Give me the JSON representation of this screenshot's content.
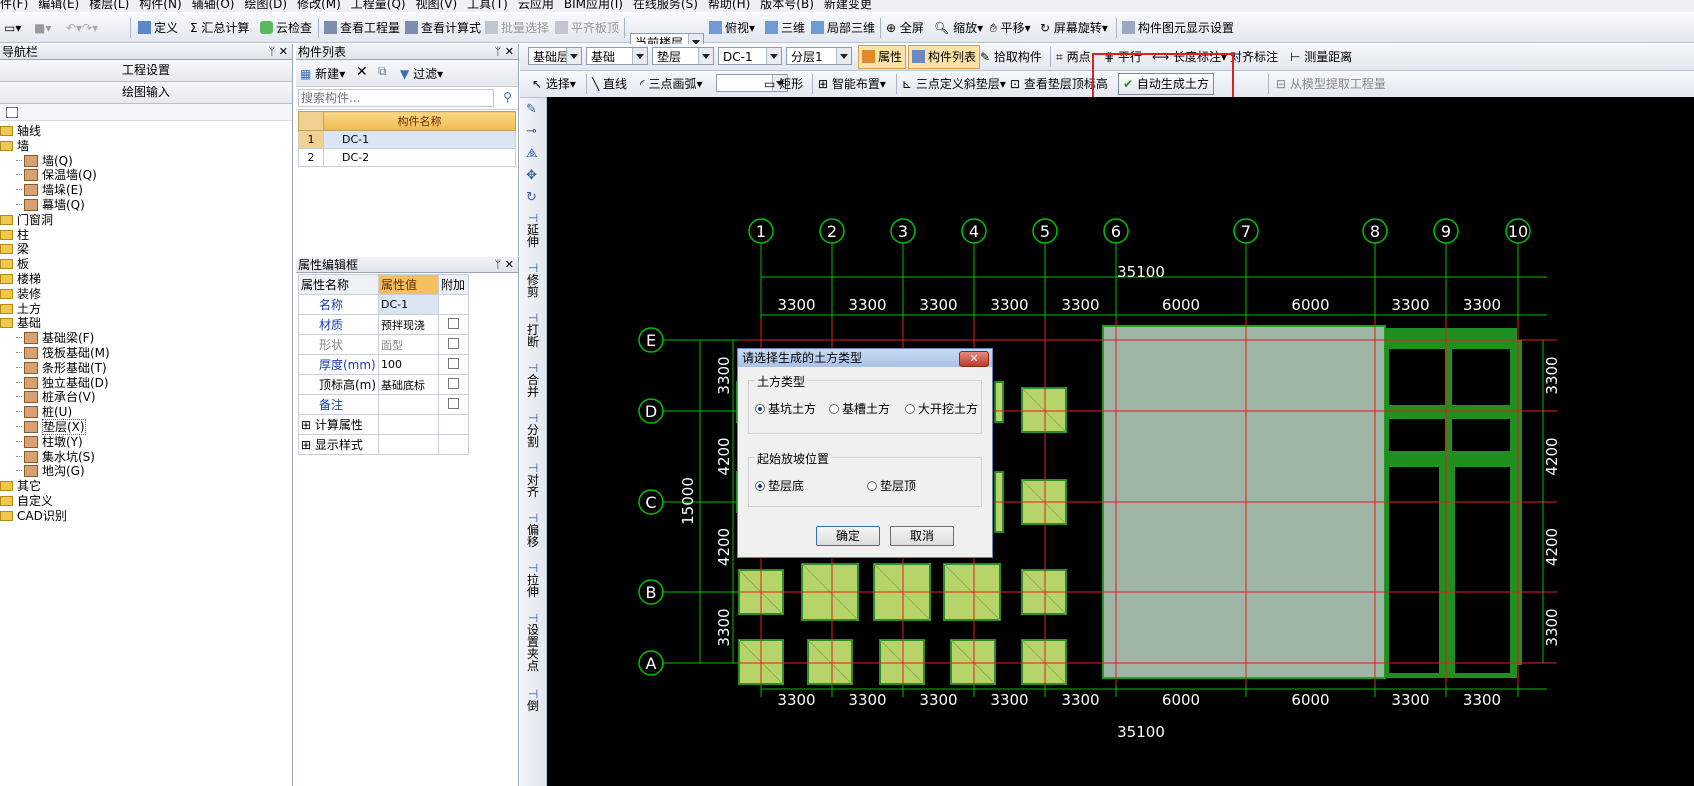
{
  "menu": [
    "件(F)",
    "编辑(E)",
    "楼层(L)",
    "构件(N)",
    "辅轴(O)",
    "绘图(D)",
    "修改(M)",
    "工程量(Q)",
    "视图(V)",
    "工具(T)",
    "云应用",
    "BIM应用(I)",
    "在线服务(S)",
    "帮助(H)",
    "版本号(B)",
    "新建变更"
  ],
  "toolbar1": {
    "define": "定义",
    "summary": "汇总计算",
    "cloud_check": "云检查",
    "view_qty": "查看工程量",
    "view_formula": "查看计算式",
    "batch_select": "批量选择",
    "flat_slab": "平齐板顶",
    "floor": "当前楼层",
    "top_view": "俯视",
    "three_d": "三维",
    "local_3d": "局部三维",
    "fullscreen": "全屏",
    "zoom": "缩放",
    "pan": "平移",
    "rotate": "屏幕旋转",
    "display_settings": "构件图元显示设置"
  },
  "toolbar2": {
    "layer": "基础层",
    "category": "基础",
    "type": "垫层",
    "component": "DC-1",
    "sublayer": "分层1",
    "props": "属性",
    "comp_list": "构件列表",
    "pick": "拾取构件",
    "two_point": "两点",
    "parallel": "平行",
    "length_dim": "长度标注",
    "align_dim": "对齐标注",
    "measure": "测量距离"
  },
  "toolbar3": {
    "select": "选择",
    "line": "直线",
    "arc": "三点画弧",
    "rect": "矩形",
    "smart": "智能布置",
    "slope": "三点定义斜垫层",
    "view_top": "查看垫层顶标高",
    "auto_earth": "自动生成土方",
    "extract": "从模型提取工程量"
  },
  "nav": {
    "title": "导航栏",
    "project_settings": "工程设置",
    "draw_input": "绘图输入",
    "tree": [
      {
        "label": "轴线",
        "level": 0,
        "kind": "folder"
      },
      {
        "label": "墙",
        "level": 0,
        "kind": "folder"
      },
      {
        "label": "墙(Q)",
        "level": 1,
        "kind": "item"
      },
      {
        "label": "保温墙(Q)",
        "level": 1,
        "kind": "item"
      },
      {
        "label": "墙垛(E)",
        "level": 1,
        "kind": "item"
      },
      {
        "label": "幕墙(Q)",
        "level": 1,
        "kind": "item"
      },
      {
        "label": "门窗洞",
        "level": 0,
        "kind": "folder"
      },
      {
        "label": "柱",
        "level": 0,
        "kind": "folder"
      },
      {
        "label": "梁",
        "level": 0,
        "kind": "folder"
      },
      {
        "label": "板",
        "level": 0,
        "kind": "folder"
      },
      {
        "label": "楼梯",
        "level": 0,
        "kind": "folder"
      },
      {
        "label": "装修",
        "level": 0,
        "kind": "folder"
      },
      {
        "label": "土方",
        "level": 0,
        "kind": "folder"
      },
      {
        "label": "基础",
        "level": 0,
        "kind": "folder"
      },
      {
        "label": "基础梁(F)",
        "level": 1,
        "kind": "item"
      },
      {
        "label": "筏板基础(M)",
        "level": 1,
        "kind": "item"
      },
      {
        "label": "条形基础(T)",
        "level": 1,
        "kind": "item"
      },
      {
        "label": "独立基础(D)",
        "level": 1,
        "kind": "item"
      },
      {
        "label": "桩承台(V)",
        "level": 1,
        "kind": "item"
      },
      {
        "label": "桩(U)",
        "level": 1,
        "kind": "item"
      },
      {
        "label": "垫层(X)",
        "level": 1,
        "kind": "item"
      },
      {
        "label": "柱墩(Y)",
        "level": 1,
        "kind": "item"
      },
      {
        "label": "集水坑(S)",
        "level": 1,
        "kind": "item"
      },
      {
        "label": "地沟(G)",
        "level": 1,
        "kind": "item"
      },
      {
        "label": "其它",
        "level": 0,
        "kind": "folder"
      },
      {
        "label": "自定义",
        "level": 0,
        "kind": "folder"
      },
      {
        "label": "CAD识别",
        "level": 0,
        "kind": "folder"
      }
    ]
  },
  "complist": {
    "title": "构件列表",
    "new": "新建",
    "filter": "过滤",
    "search_placeholder": "搜索构件...",
    "header": "构件名称",
    "rows": [
      {
        "no": "1",
        "name": "DC-1"
      },
      {
        "no": "2",
        "name": "DC-2"
      }
    ]
  },
  "props": {
    "title": "属性编辑框",
    "h_name": "属性名称",
    "h_value": "属性值",
    "h_extra": "附加",
    "rows": [
      {
        "name": "名称",
        "value": "DC-1",
        "blue": true
      },
      {
        "name": "材质",
        "value": "预拌现浇",
        "blue": true
      },
      {
        "name": "形状",
        "value": "面型",
        "blue": false,
        "gray": true
      },
      {
        "name": "厚度(mm)",
        "value": "100",
        "blue": true
      },
      {
        "name": "顶标高(m)",
        "value": "基础底标",
        "blue": false
      },
      {
        "name": "备注",
        "value": "",
        "blue": true
      },
      {
        "name": "计算属性",
        "value": "",
        "blue": false,
        "expand": true
      },
      {
        "name": "显示样式",
        "value": "",
        "blue": false,
        "expand": true
      }
    ]
  },
  "vtools": [
    "延伸",
    "修剪",
    "打断",
    "合并",
    "分割",
    "对齐",
    "偏移",
    "拉伸",
    "设置夹点",
    "倒"
  ],
  "drawing": {
    "col_labels": [
      "1",
      "2",
      "3",
      "4",
      "5",
      "6",
      "7",
      "8",
      "9",
      "10"
    ],
    "row_labels": [
      "E",
      "D",
      "C",
      "B",
      "A"
    ],
    "total_dim": "35100",
    "spacings": [
      "3300",
      "3300",
      "3300",
      "3300",
      "3300",
      "6000",
      "6000",
      "3300",
      "3300"
    ],
    "left_total": "15000",
    "left_spacings": [
      "3300",
      "4200",
      "4200",
      "3300"
    ],
    "right_spacings": [
      "3300",
      "4200",
      "4200",
      "3300"
    ]
  },
  "dialog": {
    "title": "请选择生成的土方类型",
    "group1": "土方类型",
    "opt1": "基坑土方",
    "opt2": "基槽土方",
    "opt3": "大开挖土方",
    "group2": "起始放坡位置",
    "opt4": "垫层底",
    "opt5": "垫层顶",
    "ok": "确定",
    "cancel": "取消"
  },
  "colors": {
    "highlight": "#e02020",
    "grid_green": "#00c000",
    "pad_fill": "#b7d46a",
    "raft_fill": "#9fb5a6",
    "wall_green": "#1f8f1f"
  }
}
